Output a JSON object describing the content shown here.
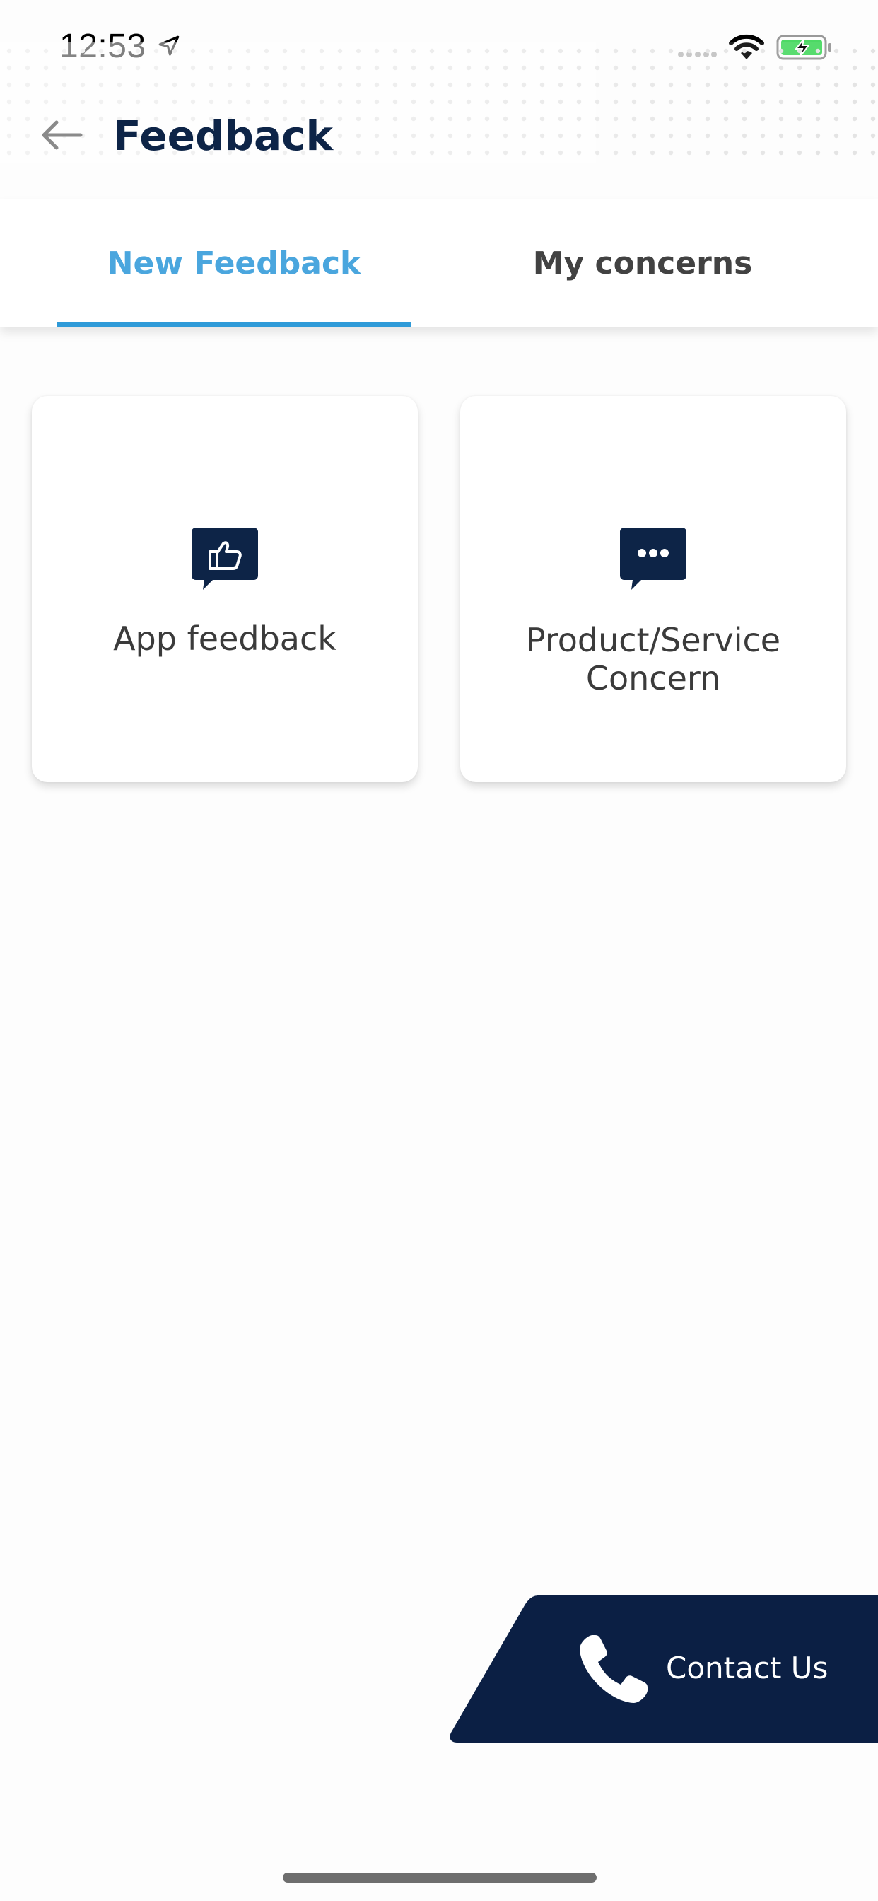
{
  "status_bar": {
    "time": "12:53",
    "icons": [
      "location-arrow-icon",
      "signal-icon",
      "wifi-icon",
      "battery-charging-icon"
    ]
  },
  "header": {
    "title": "Feedback",
    "back_icon": "arrow-left-icon"
  },
  "tabs": [
    {
      "label": "New Feedback",
      "active": true
    },
    {
      "label": "My concerns",
      "active": false
    }
  ],
  "cards": [
    {
      "label": "App feedback",
      "icon": "thumbs-up-chat-icon"
    },
    {
      "label_line1": "Product/Service",
      "label_line2": "Concern",
      "icon": "chat-ellipsis-icon"
    }
  ],
  "contact": {
    "label": "Contact Us",
    "icon": "phone-icon"
  },
  "colors": {
    "navy": "#0d2447",
    "accent": "#2e9ad8",
    "active_tab_text": "#4aa6de",
    "inactive_tab_text": "#424242",
    "contact_bg": "#0b1f44"
  }
}
